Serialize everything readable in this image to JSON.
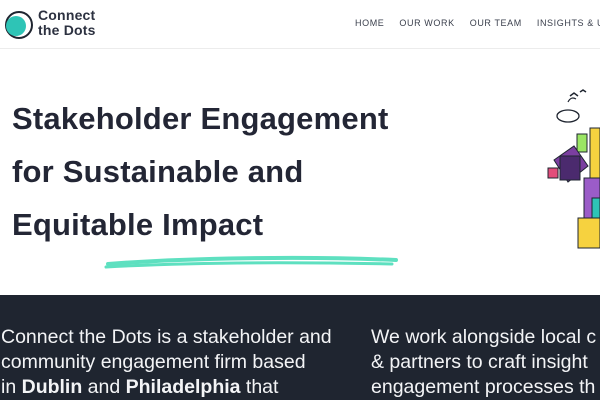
{
  "brand": {
    "line1": "Connect",
    "line2": "the Dots",
    "logo_color": "#2ec4b6"
  },
  "nav": {
    "items": [
      "HOME",
      "OUR WORK",
      "OUR TEAM",
      "INSIGHTS & UPD"
    ]
  },
  "hero": {
    "title_lines": [
      "Stakeholder Engagement",
      "for Sustainable and",
      "Equitable Impact"
    ],
    "underline_color": "#5ee0c0"
  },
  "about": {
    "col1": {
      "line1": "Connect the Dots is a stakeholder and",
      "line2": "community engagement firm based",
      "line3_pre": "in ",
      "city1": "Dublin",
      "line3_mid": " and ",
      "city2": "Philadelphia",
      "line3_post": " that"
    },
    "col2": {
      "line1": "We work alongside local c",
      "line2": "& partners to craft insight",
      "line3": "engagement processes th"
    }
  },
  "colors": {
    "dark_band": "#1f2530",
    "text_dark": "#232635"
  }
}
